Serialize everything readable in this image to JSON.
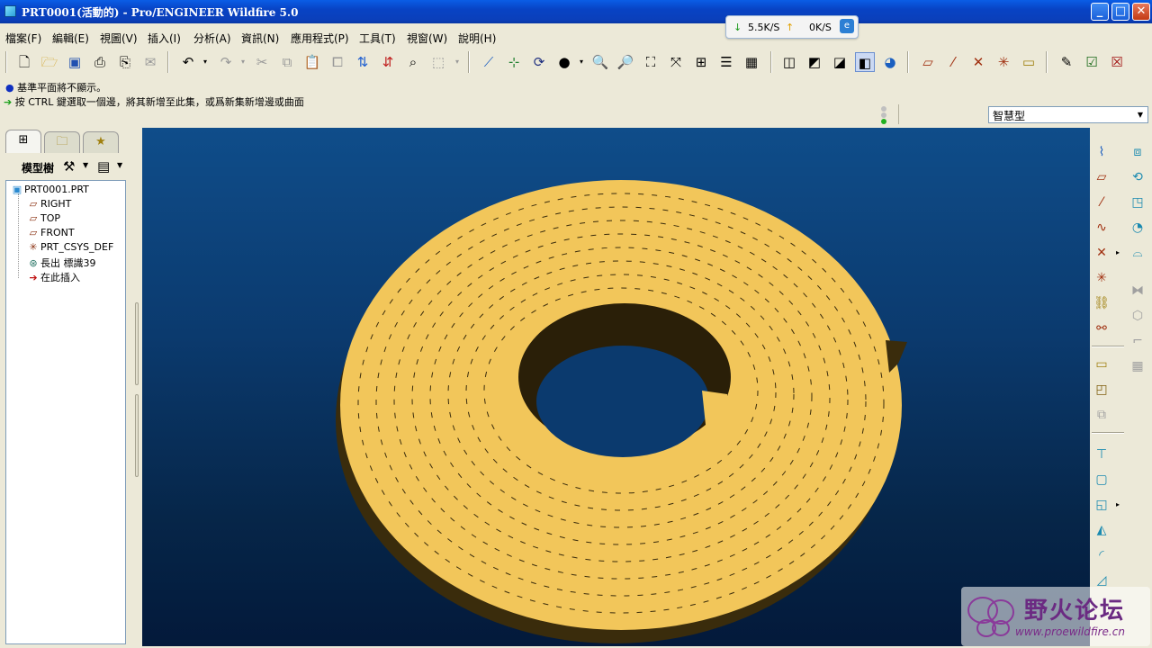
{
  "window": {
    "title": "PRT0001(活動的) - Pro/ENGINEER Wildfire 5.0"
  },
  "netmeter": {
    "down": "5.5K/S",
    "up": "0K/S"
  },
  "menu": [
    "檔案(F)",
    "編輯(E)",
    "視圖(V)",
    "插入(I)",
    "分析(A)",
    "資訊(N)",
    "應用程式(P)",
    "工具(T)",
    "視窗(W)",
    "說明(H)"
  ],
  "messages": {
    "line1": "基準平面將不顯示。",
    "line2": "按 CTRL 鍵選取一個邊，將其新增至此集，或爲新集新增邊或曲面"
  },
  "filter": {
    "value": "智慧型"
  },
  "model_tree": {
    "title": "模型樹",
    "items": [
      {
        "label": "PRT0001.PRT",
        "icon": "part-icon"
      },
      {
        "label": "RIGHT",
        "icon": "datum-plane-icon"
      },
      {
        "label": "TOP",
        "icon": "datum-plane-icon"
      },
      {
        "label": "FRONT",
        "icon": "datum-plane-icon"
      },
      {
        "label": "PRT_CSYS_DEF",
        "icon": "csys-icon"
      },
      {
        "label": "長出 標識39",
        "icon": "protrusion-icon"
      },
      {
        "label": "在此插入",
        "icon": "insert-here-arrow-icon"
      }
    ]
  },
  "watermark": {
    "brand": "野火论坛",
    "url": "www.proewildfire.cn"
  },
  "colors": {
    "model": "#f2c65a",
    "model_side": "#3a2c0c",
    "viewport_top": "#0f4d8a",
    "viewport_bottom": "#03193a"
  }
}
